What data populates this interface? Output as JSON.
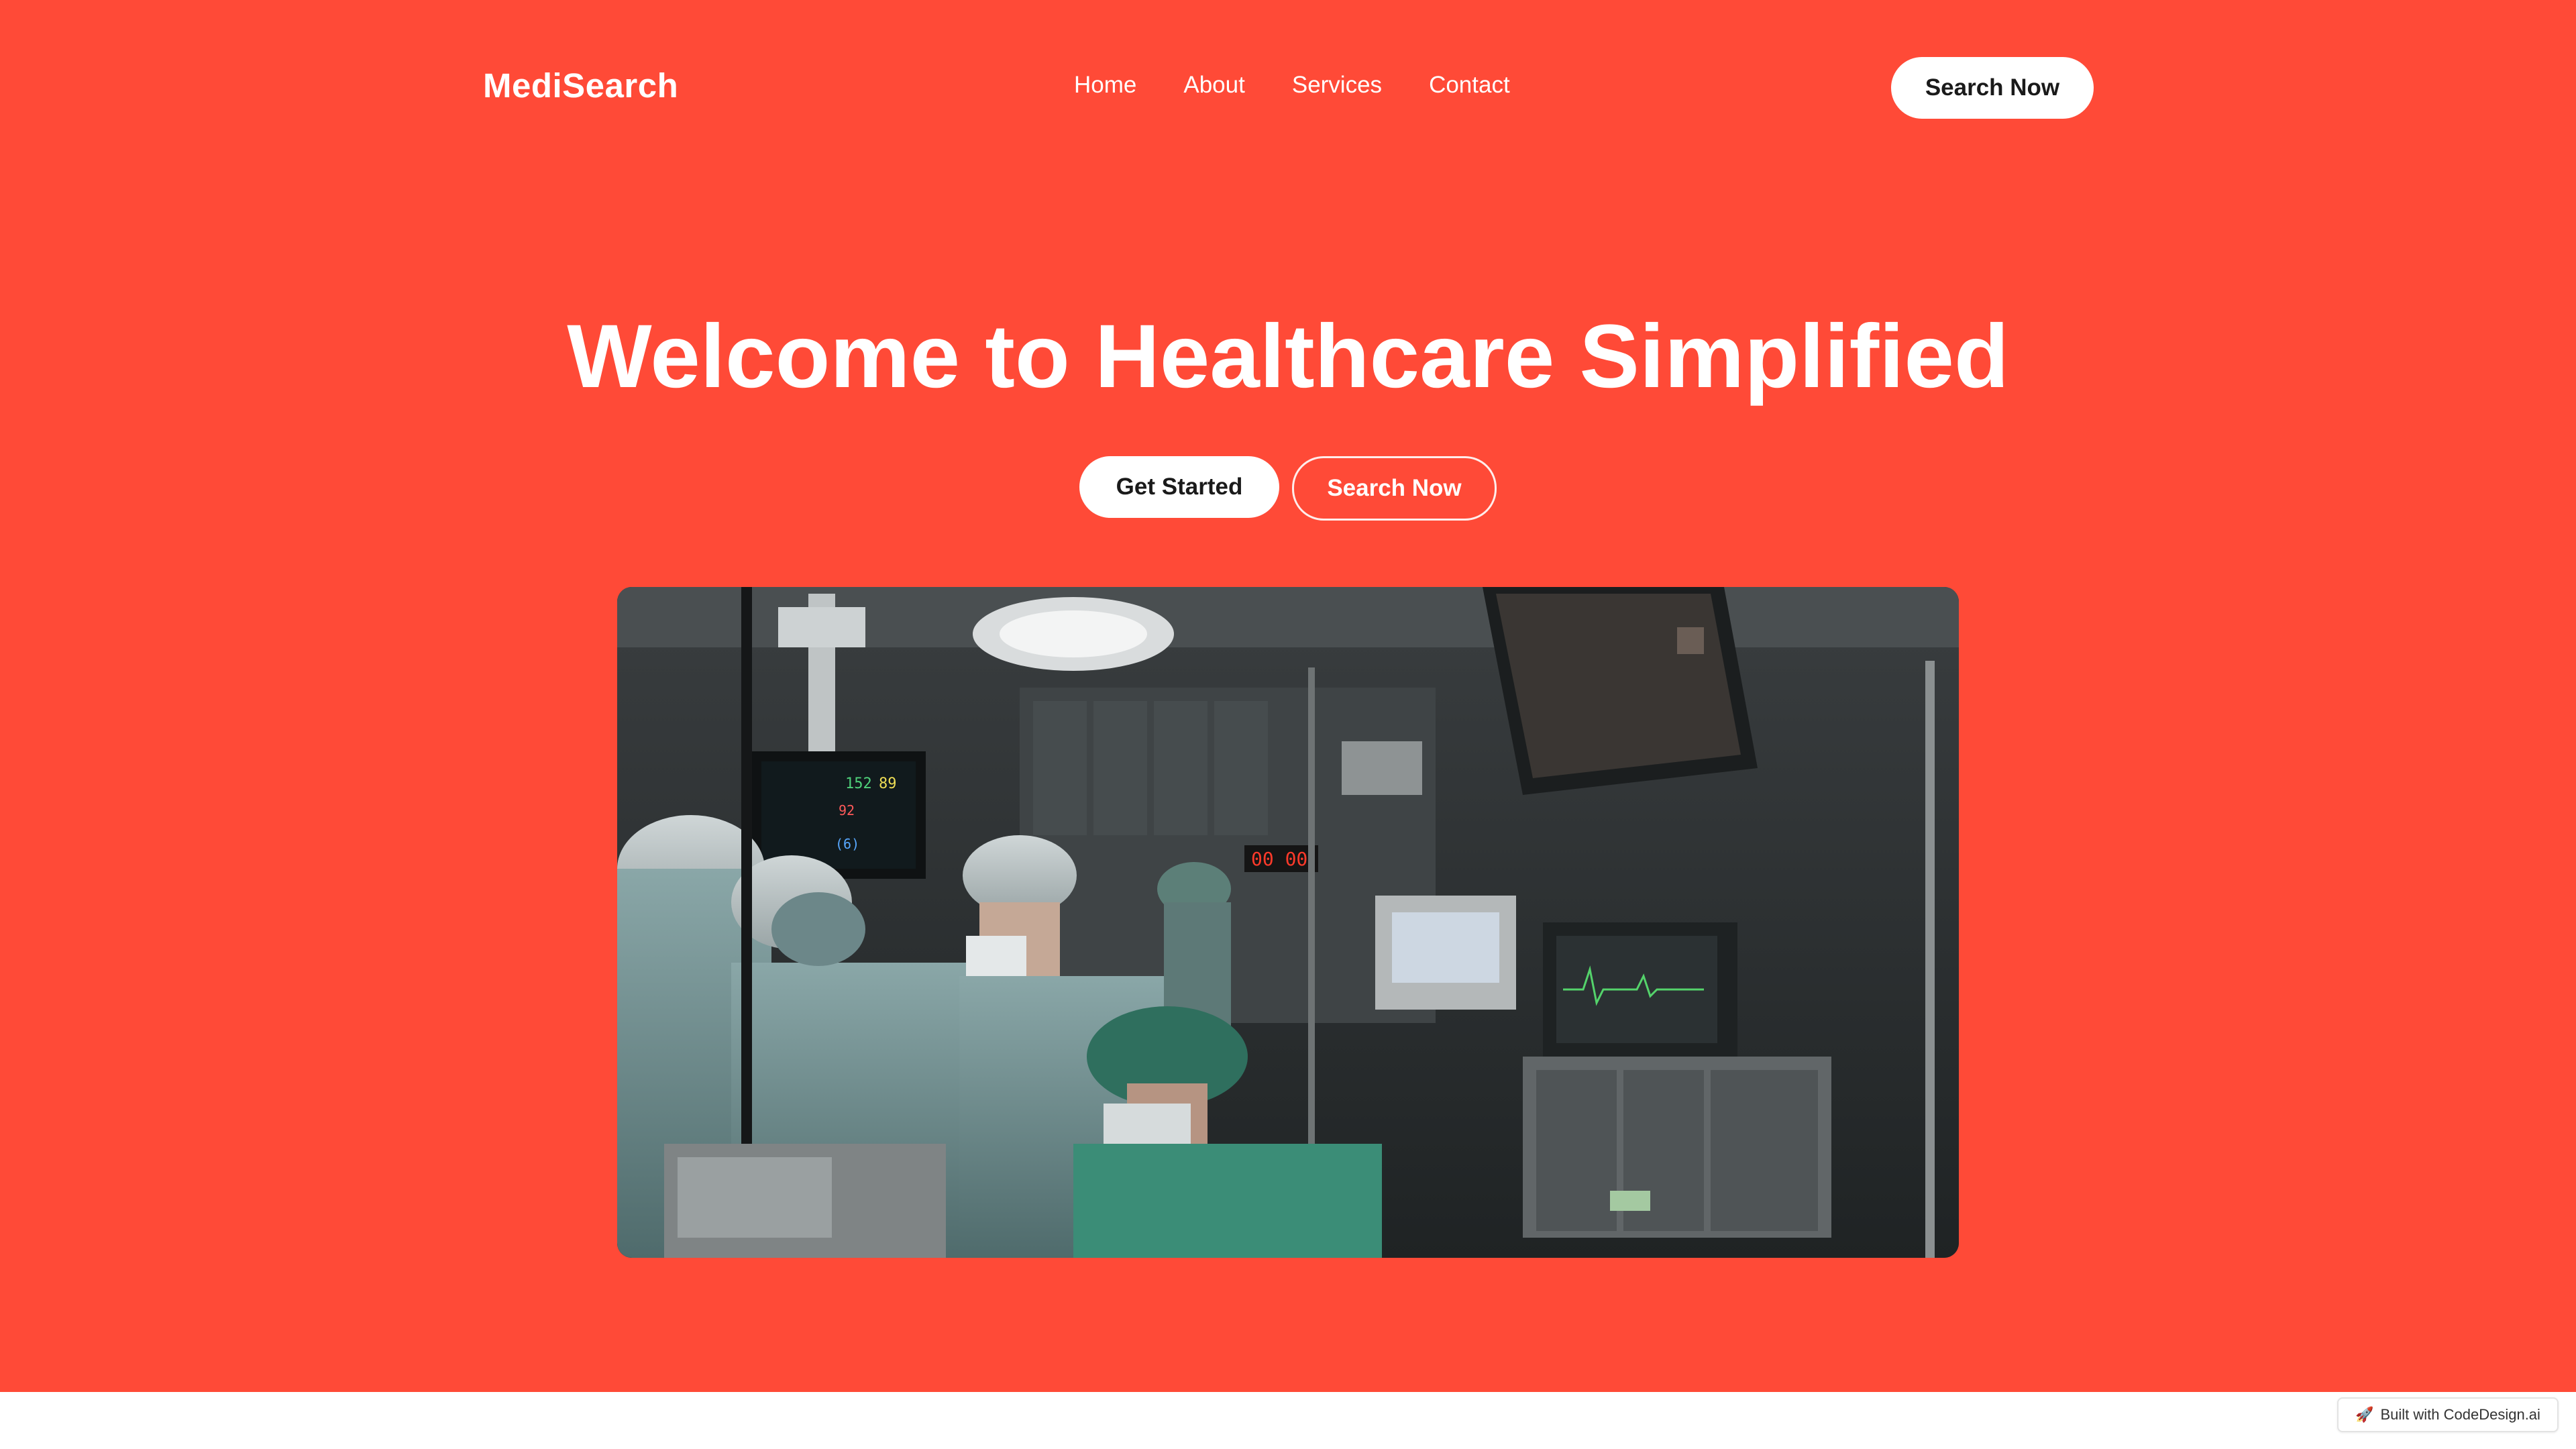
{
  "brand": {
    "logo_text": "MediSearch",
    "accent_color": "#ff4a37"
  },
  "nav": {
    "items": [
      {
        "label": "Home"
      },
      {
        "label": "About"
      },
      {
        "label": "Services"
      },
      {
        "label": "Contact"
      }
    ]
  },
  "header": {
    "cta_label": "Search Now"
  },
  "hero": {
    "title": "Welcome to Healthcare Simplified",
    "primary_cta": "Get Started",
    "secondary_cta": "Search Now",
    "image_icon": "operating-room-photo"
  },
  "footer_badge": {
    "label": "Built with CodeDesign.ai",
    "icon": "rocket-icon"
  }
}
